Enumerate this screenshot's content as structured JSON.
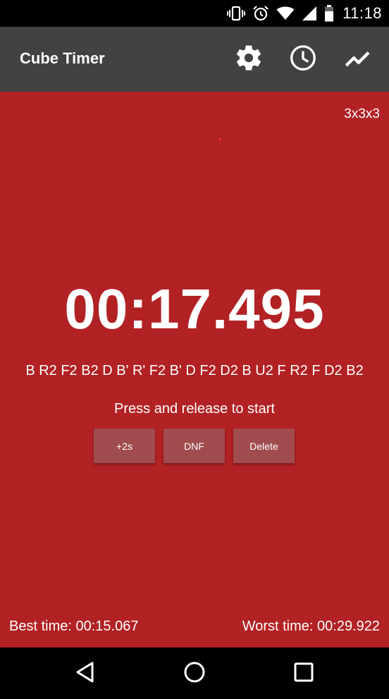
{
  "status_bar": {
    "time": "11:18",
    "icons": [
      "vibrate-icon",
      "alarm-icon",
      "wifi-icon",
      "signal-icon",
      "battery-icon"
    ]
  },
  "app_bar": {
    "title": "Cube Timer",
    "actions": [
      "settings-icon",
      "history-icon",
      "stats-icon"
    ]
  },
  "timer": {
    "puzzle_type": "3x3x3",
    "time": "00:17.495",
    "scramble": "B R2 F2 B2 D B' R' F2 B' D F2 D2 B U2 F R2 F D2 B2",
    "hint": "Press and release to start"
  },
  "buttons": {
    "plus2": "+2s",
    "dnf": "DNF",
    "delete": "Delete"
  },
  "stats": {
    "best": "Best time: 00:15.067",
    "worst": "Worst time: 00:29.922"
  },
  "colors": {
    "background": "#b22124",
    "app_bar": "#424242",
    "button": "#a04c4e"
  }
}
